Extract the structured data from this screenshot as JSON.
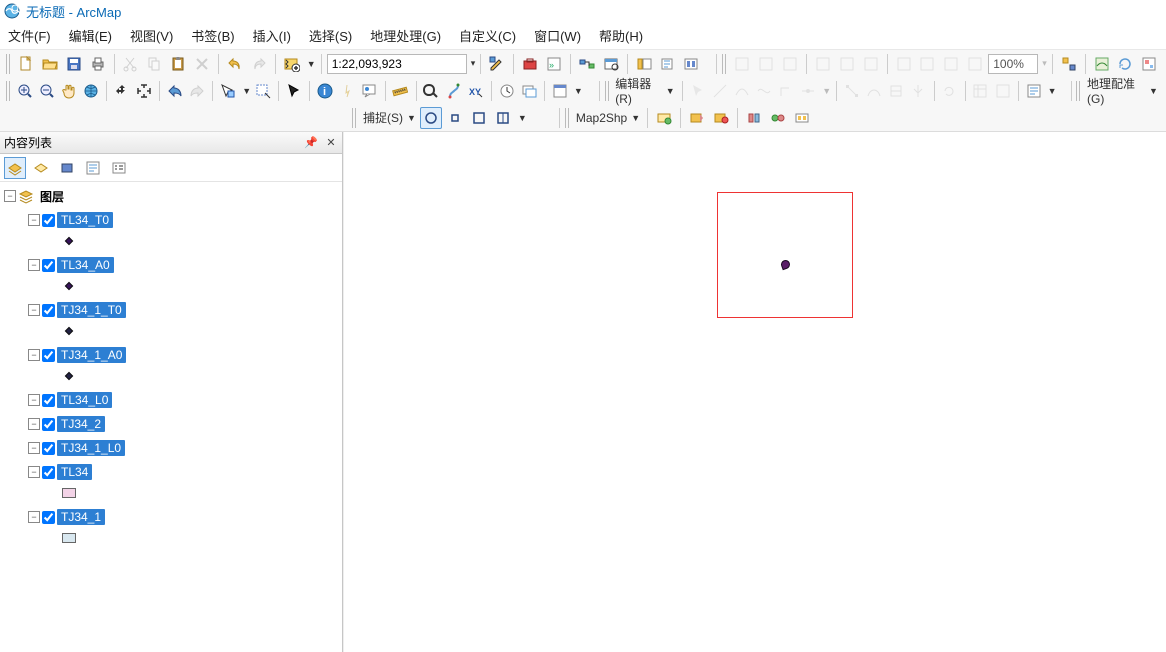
{
  "title": "无标题 - ArcMap",
  "menu": {
    "file": "文件(F)",
    "edit": "编辑(E)",
    "view": "视图(V)",
    "bookmarks": "书签(B)",
    "insert": "插入(I)",
    "selection": "选择(S)",
    "geoprocessing": "地理处理(G)",
    "customize": "自定义(C)",
    "windows": "窗口(W)",
    "help": "帮助(H)"
  },
  "scale": "1:22,093,923",
  "zoom_pct": "100%",
  "editor_label": "编辑器(R)",
  "snap_label": "捕捉(S)",
  "georef_label": "地理配准(G)",
  "map2shp_label": "Map2Shp",
  "toc": {
    "title": "内容列表",
    "root": "图层",
    "layers": [
      {
        "name": "TL34_T0",
        "sym": "point"
      },
      {
        "name": "TL34_A0",
        "sym": "point"
      },
      {
        "name": "TJ34_1_T0",
        "sym": "point dk"
      },
      {
        "name": "TJ34_1_A0",
        "sym": "point dk"
      },
      {
        "name": "TL34_L0",
        "sym": ""
      },
      {
        "name": "TJ34_2",
        "sym": ""
      },
      {
        "name": "TJ34_1_L0",
        "sym": ""
      },
      {
        "name": "TL34",
        "sym": "pink"
      },
      {
        "name": "TJ34_1",
        "sym": "blue"
      }
    ]
  }
}
